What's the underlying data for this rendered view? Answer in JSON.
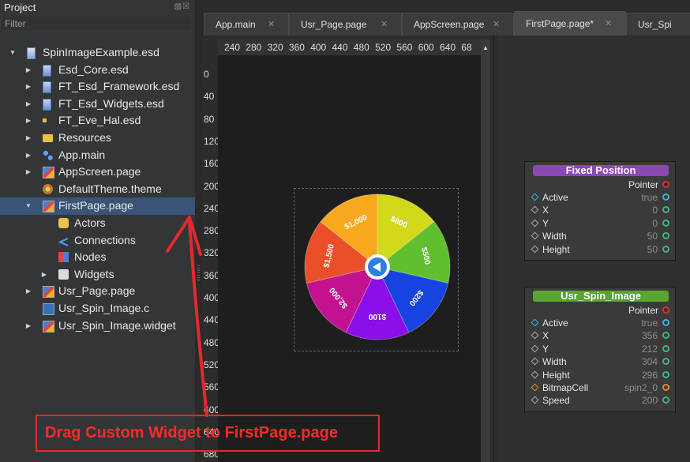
{
  "panel": {
    "title": "Project",
    "header_buttons": "▧☒",
    "filter_placeholder": "Filter"
  },
  "tree": [
    {
      "label": "SpinImageExample.esd",
      "icon": "esd-project-icon",
      "expanded": true
    },
    {
      "label": "Esd_Core.esd",
      "icon": "esd-library-icon"
    },
    {
      "label": "FT_Esd_Framework.esd",
      "icon": "esd-library-icon"
    },
    {
      "label": "FT_Esd_Widgets.esd",
      "icon": "esd-library-icon"
    },
    {
      "label": "FT_Eve_Hal.esd",
      "icon": "esd-hal-icon"
    },
    {
      "label": "Resources",
      "icon": "folder-icon"
    },
    {
      "label": "App.main",
      "icon": "main-icon"
    },
    {
      "label": "AppScreen.page",
      "icon": "page-icon"
    },
    {
      "label": "DefaultTheme.theme",
      "icon": "theme-icon"
    },
    {
      "label": "FirstPage.page",
      "icon": "page-icon",
      "expanded": true,
      "selected": true
    },
    {
      "label": "Actors",
      "icon": "actors-icon"
    },
    {
      "label": "Connections",
      "icon": "connections-icon"
    },
    {
      "label": "Nodes",
      "icon": "nodes-icon"
    },
    {
      "label": "Widgets",
      "icon": "widgets-icon"
    },
    {
      "label": "Usr_Page.page",
      "icon": "page-icon"
    },
    {
      "label": "Usr_Spin_Image.c",
      "icon": "c-file-icon"
    },
    {
      "label": "Usr_Spin_Image.widget",
      "icon": "page-icon"
    }
  ],
  "tabs": [
    {
      "label": "App.main",
      "active": false
    },
    {
      "label": "Usr_Page.page",
      "active": false
    },
    {
      "label": "AppScreen.page",
      "active": false
    },
    {
      "label": "FirstPage.page*",
      "active": true
    },
    {
      "label": "Usr_Spi",
      "active": false
    }
  ],
  "ruler_top": [
    "240",
    "280",
    "320",
    "360",
    "400",
    "440",
    "480",
    "520",
    "560",
    "600",
    "640",
    "68"
  ],
  "ruler_left": [
    "0",
    "40",
    "80",
    "120",
    "160",
    "200",
    "240",
    "280",
    "320",
    "360",
    "400",
    "440",
    "480",
    "520",
    "560",
    "600",
    "640",
    "680"
  ],
  "wheel": {
    "segments": [
      {
        "label": "$100",
        "color": "#8a0fe8"
      },
      {
        "label": "$2,000",
        "color": "#c2128f"
      },
      {
        "label": "$1,500",
        "color": "#e9502a"
      },
      {
        "label": "$1,000",
        "color": "#f7a81c"
      },
      {
        "label": "$800",
        "color": "#d2d91a"
      },
      {
        "label": "$500",
        "color": "#5fbf2e"
      },
      {
        "label": "$200",
        "color": "#1744e0"
      }
    ]
  },
  "nodes": [
    {
      "title": "Fixed Position",
      "title_color": "#8a48b3",
      "pointer_label": "Pointer",
      "rows": [
        {
          "label": "Active",
          "value": "true",
          "pin": "diamond",
          "out_color": "#37b2d8"
        },
        {
          "label": "X",
          "value": "0",
          "pin": "diamond",
          "out_color": "#3fb57e"
        },
        {
          "label": "Y",
          "value": "0",
          "pin": "diamond",
          "out_color": "#3fb57e"
        },
        {
          "label": "Width",
          "value": "50",
          "pin": "diamond",
          "out_color": "#3fb57e"
        },
        {
          "label": "Height",
          "value": "50",
          "pin": "diamond",
          "out_color": "#3fb57e"
        }
      ]
    },
    {
      "title": "Usr_Spin_Image",
      "title_color": "#5aa52c",
      "pointer_label": "Pointer",
      "rows": [
        {
          "label": "Active",
          "value": "true",
          "pin": "diamond",
          "out_color": "#37b2d8"
        },
        {
          "label": "X",
          "value": "356",
          "pin": "diamond",
          "out_color": "#3fb57e"
        },
        {
          "label": "Y",
          "value": "212",
          "pin": "diamond",
          "out_color": "#3fb57e"
        },
        {
          "label": "Width",
          "value": "304",
          "pin": "diamond",
          "out_color": "#3fb57e"
        },
        {
          "label": "Height",
          "value": "296",
          "pin": "diamond",
          "out_color": "#3fb57e"
        },
        {
          "label": "BitmapCell",
          "value": "spin2_0",
          "pin": "orange-diamond",
          "out_color": "#e08a2a"
        },
        {
          "label": "Speed",
          "value": "200",
          "pin": "diamond",
          "out_color": "#3fb57e"
        }
      ]
    }
  ],
  "annotation": {
    "text": "Drag Custom Widget to FirstPage.page",
    "color": "#ff2a2a"
  }
}
